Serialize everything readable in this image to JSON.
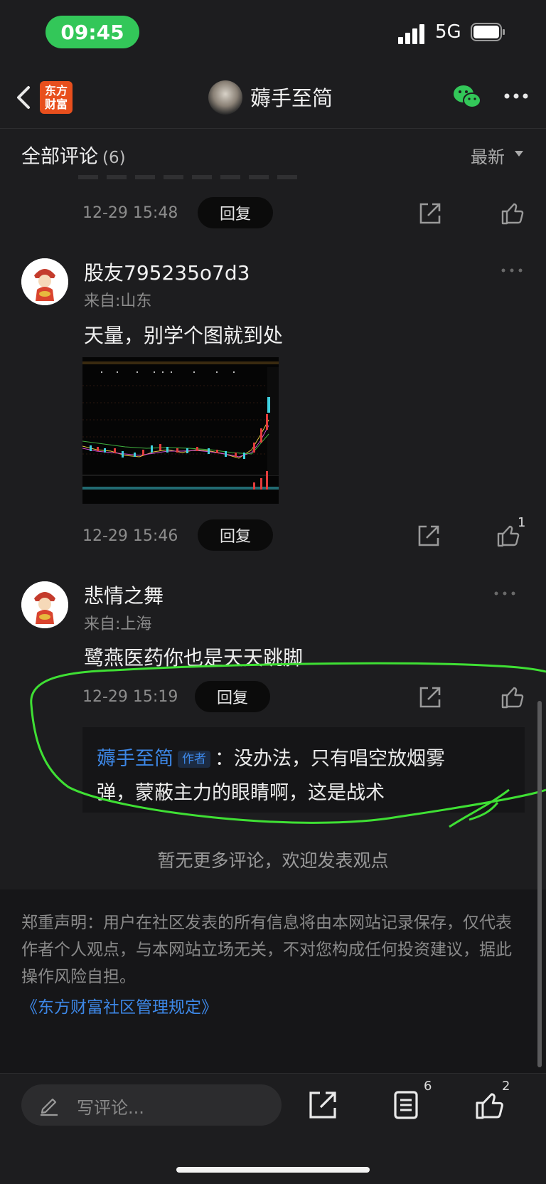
{
  "status_bar": {
    "time": "09:45",
    "network": "5G"
  },
  "header": {
    "logo_text": "东方\n财富",
    "title": "薅手至简"
  },
  "comments_header": {
    "title": "全部评论",
    "count": "(6)",
    "sort": "最新"
  },
  "comments": [
    {
      "timestamp": "12-29 15:48",
      "reply_label": "回复"
    },
    {
      "username": "股友795235o7d3",
      "location": "来自:山东",
      "text": "天量，别学个图就到处",
      "timestamp": "12-29 15:46",
      "reply_label": "回复",
      "like_count": "1"
    },
    {
      "username": "悲情之舞",
      "location": "来自:上海",
      "text": "鹭燕医药你也是天天跳脚",
      "timestamp": "12-29 15:19",
      "reply_label": "回复",
      "author_reply": {
        "name": "薅手至简",
        "tag": "作者",
        "text_line1": "：没办法，只有唱空放烟雾",
        "text_line2": "弹，蒙蔽主力的眼睛啊，这是战术"
      }
    }
  ],
  "no_more": "暂无更多评论，欢迎发表观点",
  "disclaimer": {
    "text": "郑重声明：用户在社区发表的所有信息将由本网站记录保存，仅代表作者个人观点，与本网站立场无关，不对您构成任何投资建议，据此操作风险自担。",
    "link": "《东方财富社区管理规定》"
  },
  "bottom_bar": {
    "placeholder": "写评论...",
    "comment_count": "6",
    "like_count": "2"
  },
  "colors": {
    "accent_green": "#33c759",
    "link_blue": "#3d87e6",
    "logo_orange": "#e84f1d"
  }
}
